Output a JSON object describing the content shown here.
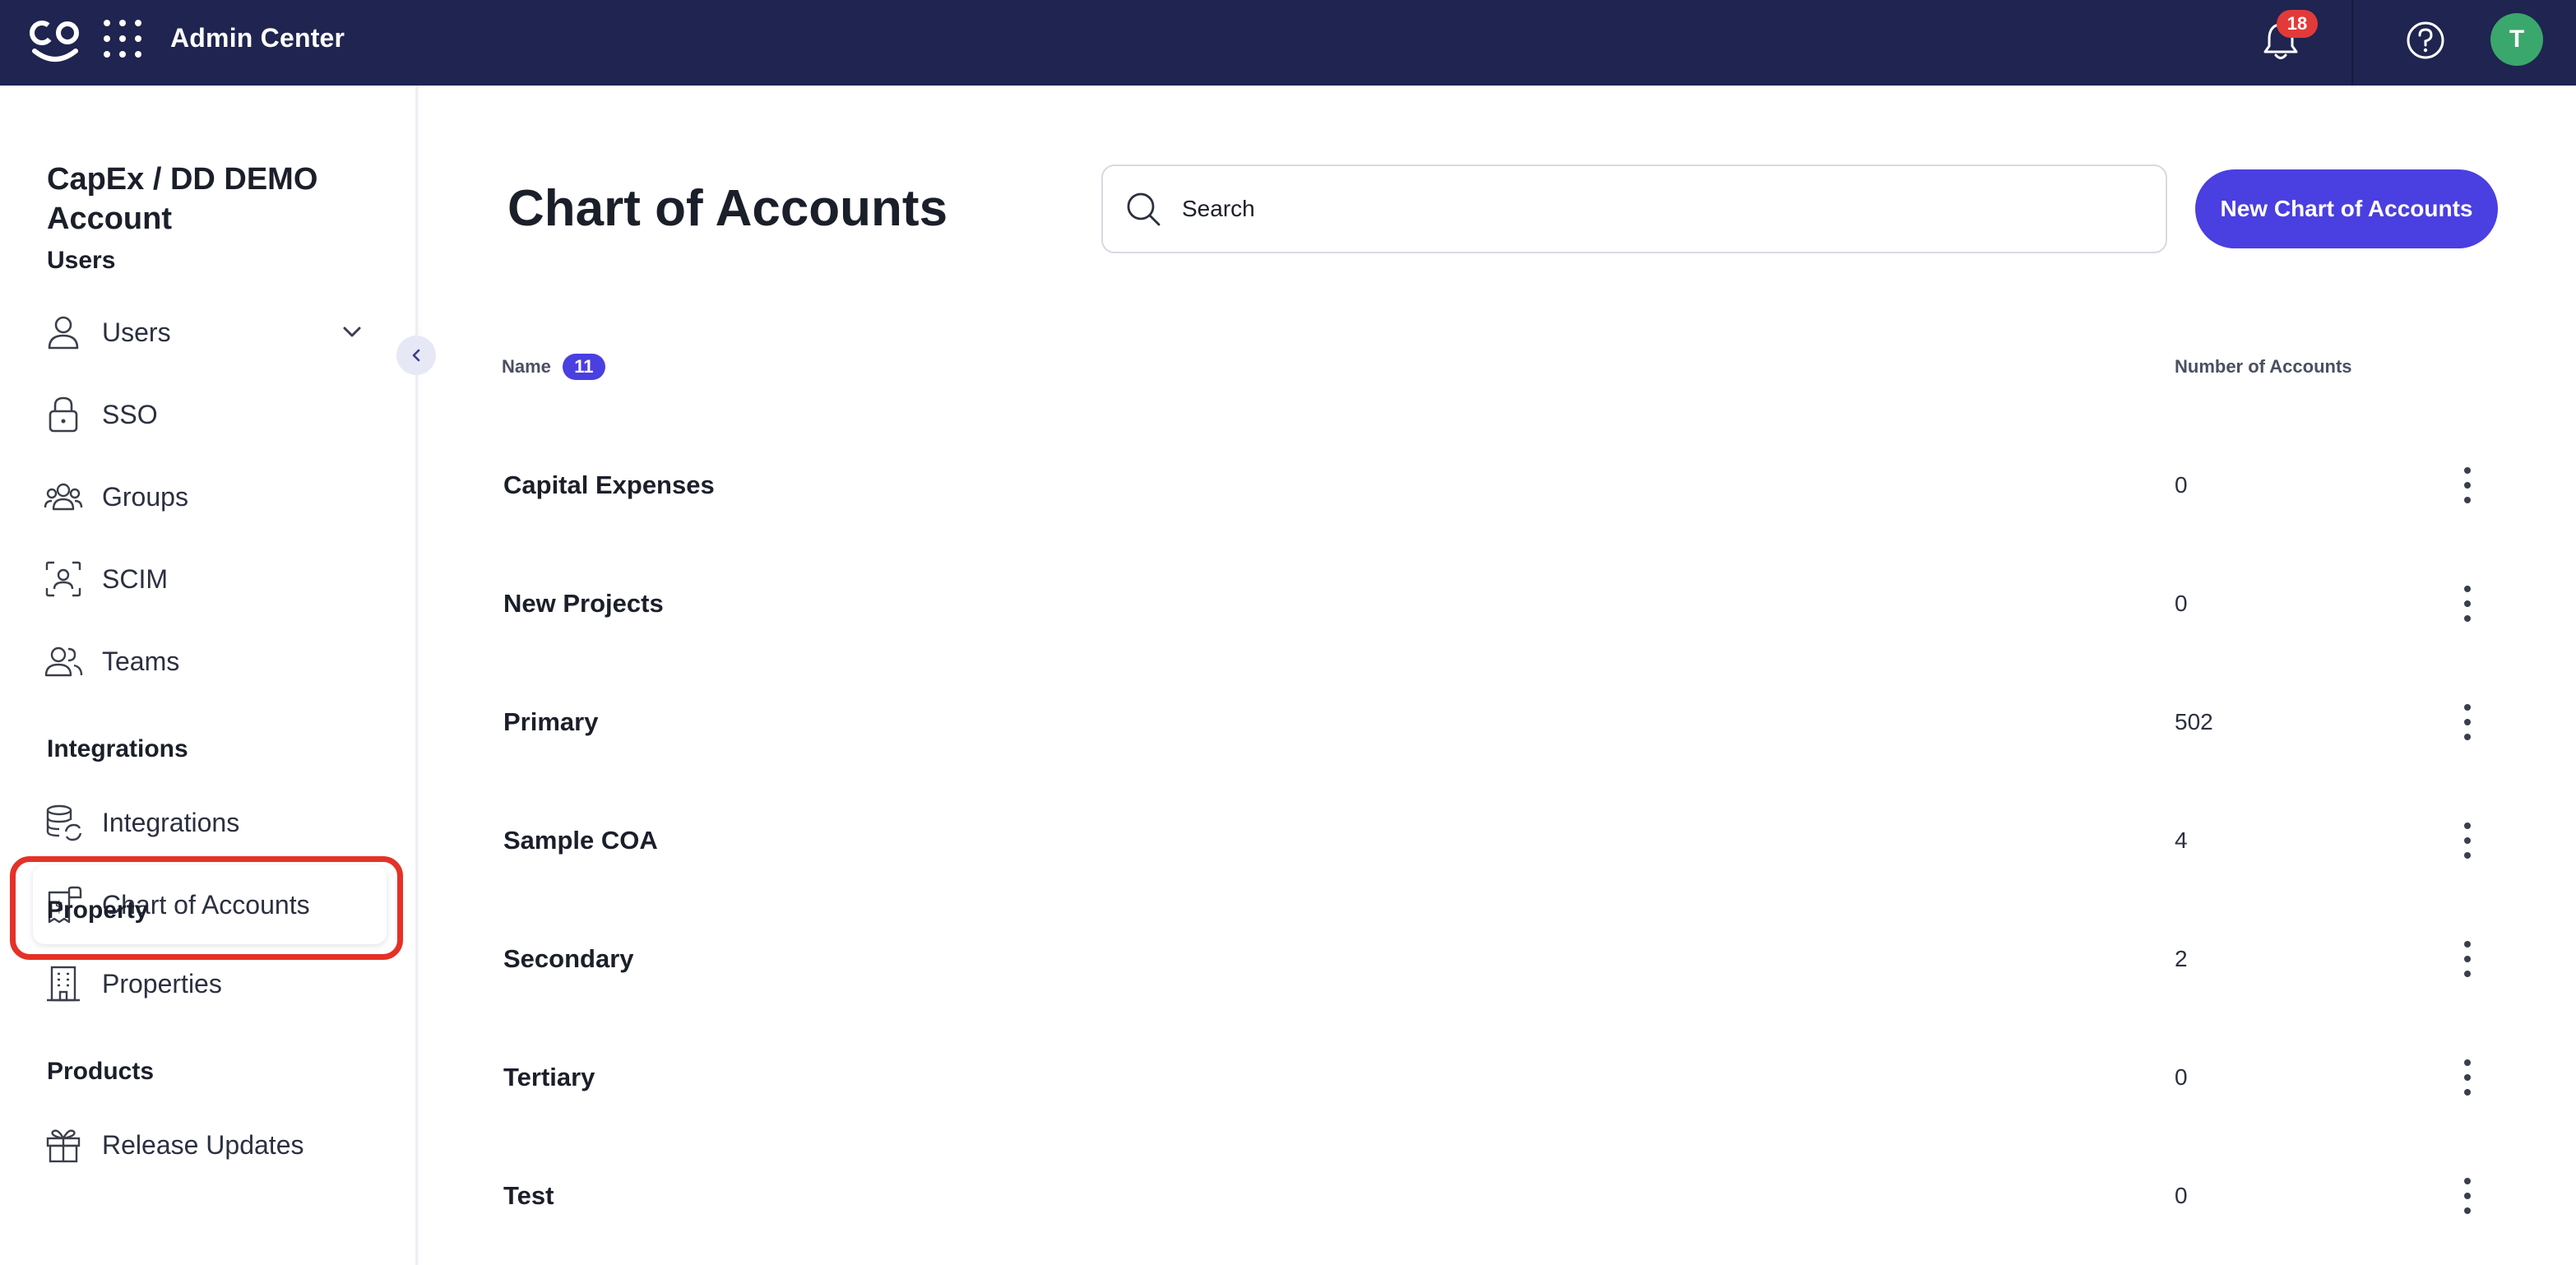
{
  "topbar": {
    "app_title": "Admin Center",
    "notification_count": "18",
    "avatar_initial": "T",
    "colors": {
      "bar": "#1f2450",
      "badge": "#e23a3a",
      "avatar": "#3aa76d"
    }
  },
  "sidebar": {
    "account_name": "CapEx / DD DEMO Account",
    "sections": {
      "users": "Users",
      "integrations": "Integrations",
      "property": "Property",
      "products": "Products"
    },
    "items": {
      "users": "Users",
      "sso": "SSO",
      "groups": "Groups",
      "scim": "SCIM",
      "teams": "Teams",
      "integrations": "Integrations",
      "chart_of_accounts": "Chart of Accounts",
      "properties": "Properties",
      "release_updates": "Release Updates"
    },
    "active_item": "Chart of Accounts"
  },
  "main": {
    "title": "Chart of Accounts",
    "search_placeholder": "Search",
    "new_button": "New Chart of Accounts",
    "columns": {
      "name": "Name",
      "count": "11",
      "number": "Number of Accounts"
    },
    "rows": [
      {
        "name": "Capital Expenses",
        "accounts": "0"
      },
      {
        "name": "New Projects",
        "accounts": "0"
      },
      {
        "name": "Primary",
        "accounts": "502"
      },
      {
        "name": "Sample COA",
        "accounts": "4"
      },
      {
        "name": "Secondary",
        "accounts": "2"
      },
      {
        "name": "Tertiary",
        "accounts": "0"
      },
      {
        "name": "Test",
        "accounts": "0"
      }
    ],
    "accent_color": "#4a3fe0"
  }
}
